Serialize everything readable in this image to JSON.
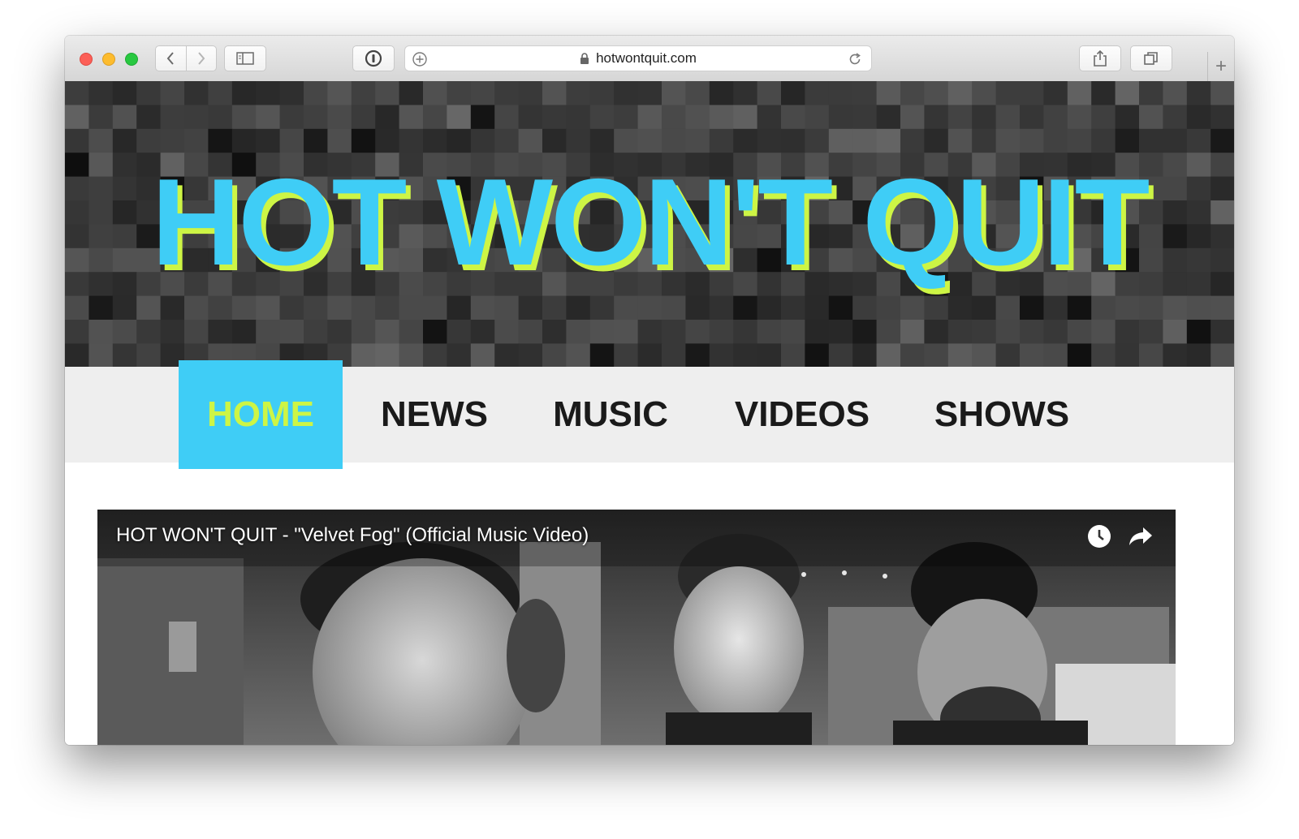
{
  "browser": {
    "url": "hotwontquit.com",
    "new_tab": "+"
  },
  "site": {
    "title": "HOT WON'T QUIT",
    "nav": [
      {
        "label": "HOME",
        "active": true
      },
      {
        "label": "NEWS",
        "active": false
      },
      {
        "label": "MUSIC",
        "active": false
      },
      {
        "label": "VIDEOS",
        "active": false
      },
      {
        "label": "SHOWS",
        "active": false
      }
    ]
  },
  "video": {
    "title": "HOT WON'T QUIT - \"Velvet Fog\" (Official Music Video)",
    "icons": [
      "watch-later-icon",
      "share-icon"
    ]
  },
  "colors": {
    "accent_blue": "#3fcdf6",
    "accent_lime": "#cdf545",
    "nav_bg": "#eeeeee"
  }
}
